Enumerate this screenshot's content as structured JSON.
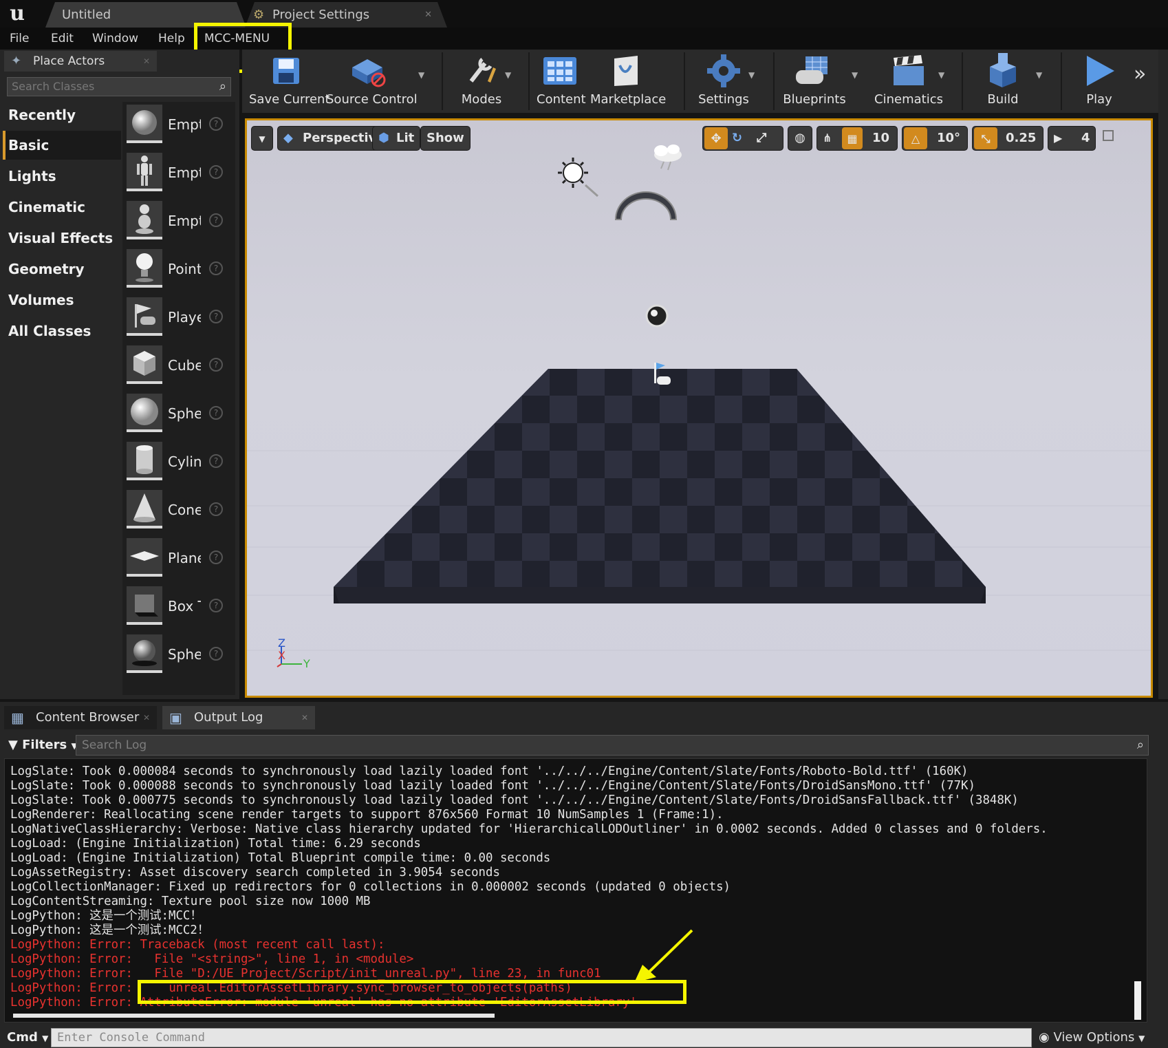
{
  "titlebar": {
    "tabs": [
      {
        "label": "Untitled"
      },
      {
        "label": "Project Settings"
      }
    ]
  },
  "menubar": {
    "items": [
      "File",
      "Edit",
      "Window",
      "Help",
      "MCC-MENU"
    ]
  },
  "place_actors": {
    "tab_label": "Place Actors",
    "search_placeholder": "Search Classes",
    "categories": [
      "Recently Placed",
      "Basic",
      "Lights",
      "Cinematic",
      "Visual Effects",
      "Geometry",
      "Volumes",
      "All Classes"
    ],
    "active_category": "Basic",
    "actors": [
      "Empt",
      "Empt",
      "Empt",
      "Point",
      "Playe",
      "Cube",
      "Sphe",
      "Cylin",
      "Cone",
      "Plane",
      "Box T",
      "Sphe"
    ]
  },
  "toolbar": {
    "buttons": [
      "Save Current",
      "Source Control",
      "Modes",
      "Content",
      "Marketplace",
      "Settings",
      "Blueprints",
      "Cinematics",
      "Build",
      "Play"
    ]
  },
  "viewport": {
    "perspective_label": "Perspective",
    "lit_label": "Lit",
    "show_label": "Show",
    "grid_snap": "10",
    "rotation_snap": "10°",
    "scale_snap": "0.25",
    "camera_speed": "4",
    "axis_labels": {
      "z": "Z",
      "x": "X",
      "y": "Y"
    }
  },
  "bottom": {
    "tabs": [
      "Content Browser",
      "Output Log"
    ],
    "filters_label": "Filters",
    "search_log_placeholder": "Search Log",
    "log_lines": [
      {
        "text": "LogSlate: Took 0.000084 seconds to synchronously load lazily loaded font '../../../Engine/Content/Slate/Fonts/Roboto-Bold.ttf' (160K)",
        "error": false
      },
      {
        "text": "LogSlate: Took 0.000088 seconds to synchronously load lazily loaded font '../../../Engine/Content/Slate/Fonts/DroidSansMono.ttf' (77K)",
        "error": false
      },
      {
        "text": "LogSlate: Took 0.000775 seconds to synchronously load lazily loaded font '../../../Engine/Content/Slate/Fonts/DroidSansFallback.ttf' (3848K)",
        "error": false
      },
      {
        "text": "LogRenderer: Reallocating scene render targets to support 876x560 Format 10 NumSamples 1 (Frame:1).",
        "error": false
      },
      {
        "text": "LogNativeClassHierarchy: Verbose: Native class hierarchy updated for 'HierarchicalLODOutliner' in 0.0002 seconds. Added 0 classes and 0 folders.",
        "error": false
      },
      {
        "text": "LogLoad: (Engine Initialization) Total time: 6.29 seconds",
        "error": false
      },
      {
        "text": "LogLoad: (Engine Initialization) Total Blueprint compile time: 0.00 seconds",
        "error": false
      },
      {
        "text": "LogAssetRegistry: Asset discovery search completed in 3.9054 seconds",
        "error": false
      },
      {
        "text": "LogCollectionManager: Fixed up redirectors for 0 collections in 0.000002 seconds (updated 0 objects)",
        "error": false
      },
      {
        "text": "LogContentStreaming: Texture pool size now 1000 MB",
        "error": false
      },
      {
        "text": "LogPython: 这是一个测试:MCC！",
        "error": false
      },
      {
        "text": "LogPython: 这是一个测试:MCC2！",
        "error": false
      },
      {
        "text": "LogPython: Error: Traceback (most recent call last):",
        "error": true
      },
      {
        "text": "LogPython: Error:   File \"<string>\", line 1, in <module>",
        "error": true
      },
      {
        "text": "LogPython: Error:   File \"D:/UE Project/Script/init_unreal.py\", line 23, in func01",
        "error": true
      },
      {
        "text": "LogPython: Error:     unreal.EditorAssetLibrary.sync_browser_to_objects(paths)",
        "error": true
      },
      {
        "text": "LogPython: Error: AttributeError: module 'unreal' has no attribute 'EditorAssetLibrary'",
        "error": true
      }
    ],
    "cmd_label": "Cmd",
    "console_placeholder": "Enter Console Command",
    "view_options_label": "View Options"
  },
  "colors": {
    "highlight": "#f5f500",
    "error_text": "#e8322f",
    "active_accent": "#d89a2c",
    "viewport_border": "#c88a00"
  }
}
